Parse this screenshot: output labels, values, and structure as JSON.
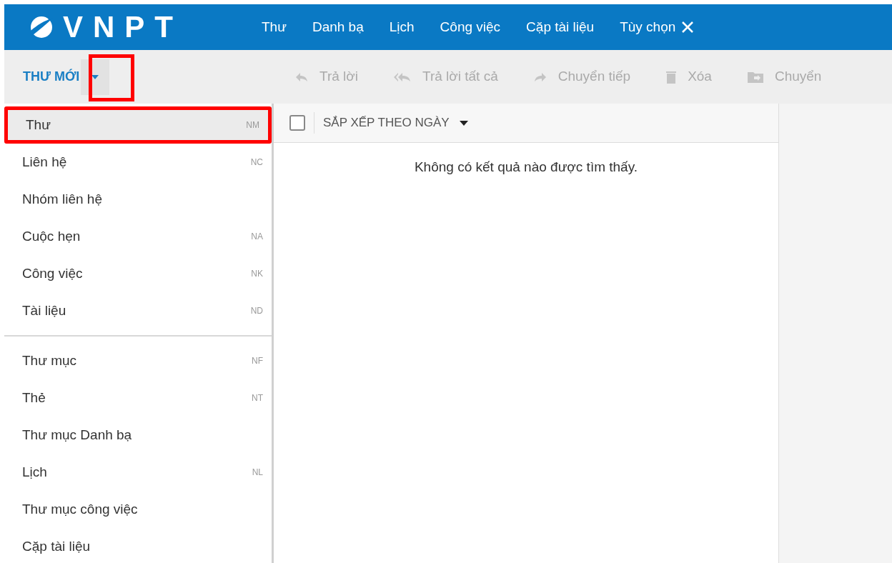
{
  "header": {
    "logo": "VNPT",
    "nav": [
      {
        "label": "Thư",
        "selected": false
      },
      {
        "label": "Danh bạ",
        "selected": false
      },
      {
        "label": "Lịch",
        "selected": false
      },
      {
        "label": "Công việc",
        "selected": false
      },
      {
        "label": "Cặp tài liệu",
        "selected": false
      },
      {
        "label": "Tùy chọn",
        "selected": false
      }
    ]
  },
  "new_button": {
    "label": "THƯ MỚI",
    "annotated": true
  },
  "toolbar": [
    {
      "label": "Trả lời",
      "kind": "reply",
      "disabled": true
    },
    {
      "label": "Trả lời tất cả",
      "kind": "reply-all",
      "disabled": true
    },
    {
      "label": "Chuyển tiếp",
      "kind": "forward",
      "disabled": true
    },
    {
      "label": "Xóa",
      "kind": "delete",
      "disabled": true
    },
    {
      "label": "Chuyển",
      "kind": "move",
      "disabled": true
    }
  ],
  "menu": [
    {
      "items": [
        {
          "label": "Thư",
          "shortcut": "NM",
          "selected": true,
          "annotated": true
        },
        {
          "label": "Liên hệ",
          "shortcut": "NC",
          "selected": false,
          "annotated": false
        },
        {
          "label": "Nhóm liên hệ",
          "selected": false,
          "annotated": false
        },
        {
          "label": "Cuộc hẹn",
          "shortcut": "NA",
          "selected": false,
          "annotated": false
        },
        {
          "label": "Công việc",
          "shortcut": "NK",
          "selected": false,
          "annotated": false
        },
        {
          "label": "Tài liệu",
          "shortcut": "ND",
          "selected": false,
          "annotated": false
        }
      ]
    },
    {
      "items": [
        {
          "label": "Thư mục",
          "shortcut": "NF",
          "selected": false,
          "annotated": false
        },
        {
          "label": "Thẻ",
          "shortcut": "NT",
          "selected": false,
          "annotated": false
        },
        {
          "label": "Thư mục Danh bạ",
          "selected": false,
          "annotated": false
        },
        {
          "label": "Lịch",
          "shortcut": "NL",
          "selected": false,
          "annotated": false
        },
        {
          "label": "Thư mục công việc",
          "selected": false,
          "annotated": false
        },
        {
          "label": "Cặp tài liệu",
          "selected": false,
          "annotated": false
        }
      ]
    }
  ],
  "list": {
    "select_all_checked": false,
    "sort_label": "SẮP XẾP THEO NGÀY",
    "empty_message": "Không có kết quả nào được tìm thấy."
  }
}
